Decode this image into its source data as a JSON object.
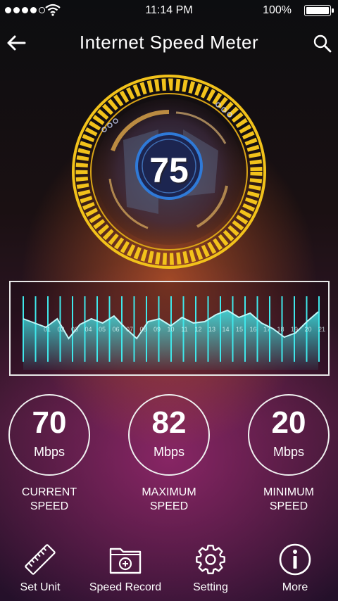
{
  "status_bar": {
    "time": "11:14 PM",
    "battery": "100%"
  },
  "header": {
    "title": "Internet Speed Meter"
  },
  "gauge": {
    "value": "75"
  },
  "graph": {
    "labels": [
      "01",
      "02",
      "03",
      "04",
      "05",
      "06",
      "07",
      "08",
      "09",
      "10",
      "11",
      "12",
      "13",
      "14",
      "15",
      "16",
      "17",
      "18",
      "19",
      "20",
      "21"
    ]
  },
  "stats": [
    {
      "value": "70",
      "unit": "Mbps",
      "label1": "CURRENT",
      "label2": "SPEED"
    },
    {
      "value": "82",
      "unit": "Mbps",
      "label1": "MAXIMUM",
      "label2": "SPEED"
    },
    {
      "value": "20",
      "unit": "Mbps",
      "label1": "MINIMUM",
      "label2": "SPEED"
    }
  ],
  "nav": [
    {
      "label": "Set Unit",
      "icon": "ruler-icon"
    },
    {
      "label": "Speed Record",
      "icon": "folder-record-icon"
    },
    {
      "label": "Setting",
      "icon": "gear-icon"
    },
    {
      "label": "More",
      "icon": "info-icon"
    }
  ],
  "colors": {
    "accent_gold": "#f2c21b",
    "accent_cyan": "#3fe7ea",
    "ring_blue": "#2f7ad8"
  }
}
